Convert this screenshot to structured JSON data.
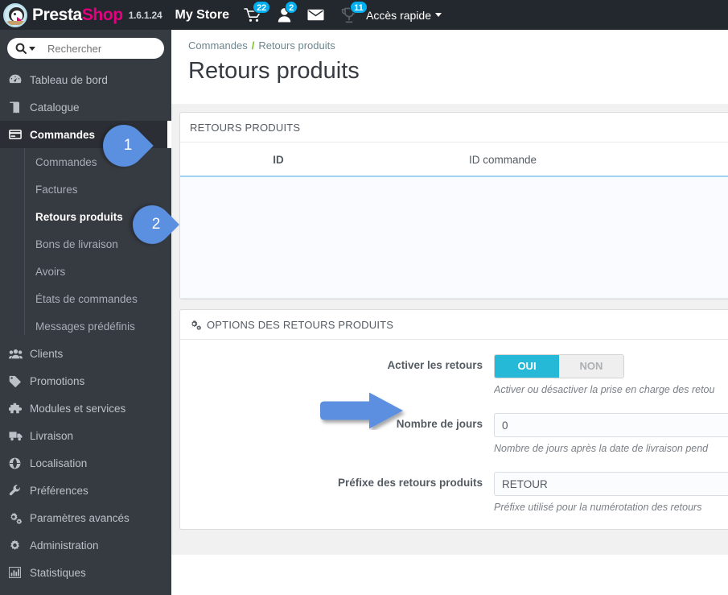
{
  "topbar": {
    "brand_first": "Presta",
    "brand_second": "Shop",
    "version": "1.6.1.24",
    "shop_name": "My Store",
    "cart_badge": "22",
    "customers_badge": "2",
    "messages_badge": "",
    "trophy_badge": "11",
    "quick_access": "Accès rapide",
    "icons": {
      "logo": "prestashop-penguin-logo",
      "cart": "shopping-cart-icon",
      "customers": "person-icon",
      "messages": "envelope-icon",
      "trophy": "trophy-icon",
      "caret": "chevron-down-icon"
    }
  },
  "sidebar": {
    "search_placeholder": "Rechercher",
    "search_value": "",
    "items": [
      {
        "label": "Tableau de bord",
        "icon": "dashboard-icon",
        "active": false
      },
      {
        "label": "Catalogue",
        "icon": "book-icon",
        "active": false
      },
      {
        "label": "Commandes",
        "icon": "orders-card-icon",
        "active": true
      },
      {
        "label": "Clients",
        "icon": "people-icon",
        "active": false
      },
      {
        "label": "Promotions",
        "icon": "tag-icon",
        "active": false
      },
      {
        "label": "Modules et services",
        "icon": "puzzle-icon",
        "active": false
      },
      {
        "label": "Livraison",
        "icon": "truck-icon",
        "active": false
      },
      {
        "label": "Localisation",
        "icon": "globe-icon",
        "active": false
      },
      {
        "label": "Préférences",
        "icon": "wrench-icon",
        "active": false
      },
      {
        "label": "Paramètres avancés",
        "icon": "gears-icon",
        "active": false
      },
      {
        "label": "Administration",
        "icon": "gear-icon",
        "active": false
      },
      {
        "label": "Statistiques",
        "icon": "bar-chart-icon",
        "active": false
      }
    ],
    "submenu": [
      {
        "label": "Commandes",
        "current": false
      },
      {
        "label": "Factures",
        "current": false
      },
      {
        "label": "Retours produits",
        "current": true
      },
      {
        "label": "Bons de livraison",
        "current": false
      },
      {
        "label": "Avoirs",
        "current": false
      },
      {
        "label": "États de commandes",
        "current": false
      },
      {
        "label": "Messages prédéfinis",
        "current": false
      }
    ]
  },
  "main": {
    "breadcrumb": {
      "parent": "Commandes",
      "separator": "/",
      "current": "Retours produits"
    },
    "page_title": "Retours produits",
    "list_panel": {
      "heading": "RETOURS PRODUITS",
      "columns": [
        "ID",
        "ID commande"
      ],
      "rows": []
    },
    "options_panel": {
      "heading": "OPTIONS DES RETOURS PRODUITS",
      "heading_icon": "gears-icon",
      "fields": [
        {
          "label": "Activer les retours",
          "type": "switch",
          "on_label": "OUI",
          "off_label": "NON",
          "value": "OUI",
          "hint": "Activer ou désactiver la prise en charge des retou"
        },
        {
          "label": "Nombre de jours",
          "type": "text",
          "value": "0",
          "hint": "Nombre de jours après la date de livraison pend"
        },
        {
          "label": "Préfixe des retours produits",
          "type": "text",
          "value": "RETOUR",
          "hint": "Préfixe utilisé pour la numérotation des retours"
        }
      ]
    }
  },
  "annotations": {
    "pin1": "1",
    "pin2": "2",
    "arrow": "pointer-arrow-right"
  },
  "colors": {
    "topbar_bg": "#23282e",
    "sidebar_bg": "#363a41",
    "accent_cyan": "#25b9d7",
    "badge_blue": "#00aff0",
    "brand_pink": "#e4007f",
    "breadcrumb_green": "#72c02c",
    "annotation_blue": "#5b8fe0"
  }
}
